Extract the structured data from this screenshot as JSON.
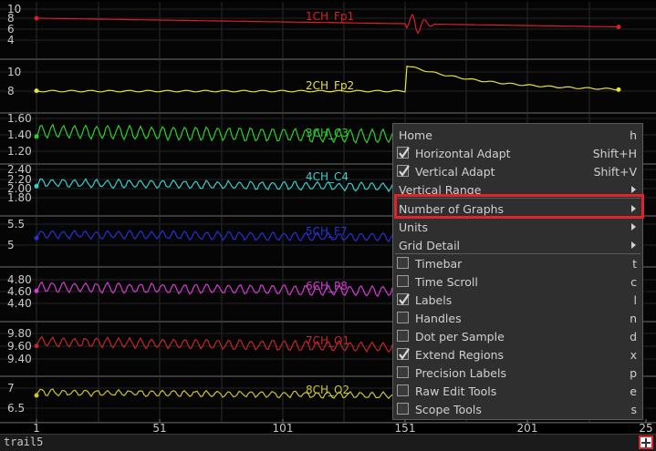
{
  "chart_data": {
    "type": "line",
    "x_ticks": [
      "1",
      "51",
      "101",
      "151",
      "201",
      "25"
    ],
    "series": [
      {
        "name": "1CH_Fp1",
        "color": "#d8202a",
        "y_ticks": [
          "10",
          "8",
          "6",
          "4"
        ]
      },
      {
        "name": "2CH_Fp2",
        "color": "#e6e23a",
        "y_ticks": [
          "10",
          "8"
        ]
      },
      {
        "name": "3CH_C3",
        "color": "#2fce2f",
        "y_ticks": [
          "1.60",
          "1.40",
          "1.20"
        ]
      },
      {
        "name": "4CH_C4",
        "color": "#35d0d0",
        "y_ticks": [
          "2.40",
          "2.20",
          "2.00",
          "1.80"
        ]
      },
      {
        "name": "5CH_F7",
        "color": "#2a2fd6",
        "y_ticks": [
          "5.5",
          "5"
        ]
      },
      {
        "name": "6CH_P8",
        "color": "#d23cd2",
        "y_ticks": [
          "4.80",
          "4.60",
          "4.40"
        ]
      },
      {
        "name": "7CH_O1",
        "color": "#c62626",
        "y_ticks": [
          "9.80",
          "9.60",
          "9.40"
        ]
      },
      {
        "name": "8CH_O2",
        "color": "#c9c72e",
        "y_ticks": [
          "7",
          "6.5"
        ]
      }
    ]
  },
  "statusbar": {
    "name": "trail5",
    "button_icon": "plus-icon"
  },
  "menu": {
    "items": [
      {
        "kind": "item",
        "label": "Home",
        "shortcut": "h"
      },
      {
        "kind": "check",
        "label": "Horizontal Adapt",
        "checked": true,
        "shortcut": "Shift+H"
      },
      {
        "kind": "check",
        "label": "Vertical Adapt",
        "checked": true,
        "shortcut": "Shift+V"
      },
      {
        "kind": "submenu",
        "label": "Vertical Range"
      },
      {
        "kind": "submenu",
        "label": "Number of Graphs"
      },
      {
        "kind": "submenu",
        "label": "Units"
      },
      {
        "kind": "submenu",
        "label": "Grid Detail"
      },
      {
        "kind": "check",
        "label": "Timebar",
        "checked": false,
        "shortcut": "t"
      },
      {
        "kind": "check",
        "label": "Time Scroll",
        "checked": false,
        "shortcut": "c"
      },
      {
        "kind": "check",
        "label": "Labels",
        "checked": true,
        "shortcut": "l"
      },
      {
        "kind": "check",
        "label": "Handles",
        "checked": false,
        "shortcut": "n"
      },
      {
        "kind": "check",
        "label": "Dot per Sample",
        "checked": false,
        "shortcut": "d"
      },
      {
        "kind": "check",
        "label": "Extend Regions",
        "checked": true,
        "shortcut": "x"
      },
      {
        "kind": "check",
        "label": "Precision Labels",
        "checked": false,
        "shortcut": "p"
      },
      {
        "kind": "check",
        "label": "Raw Edit Tools",
        "checked": false,
        "shortcut": "e"
      },
      {
        "kind": "check",
        "label": "Scope Tools",
        "checked": false,
        "shortcut": "s"
      }
    ]
  }
}
